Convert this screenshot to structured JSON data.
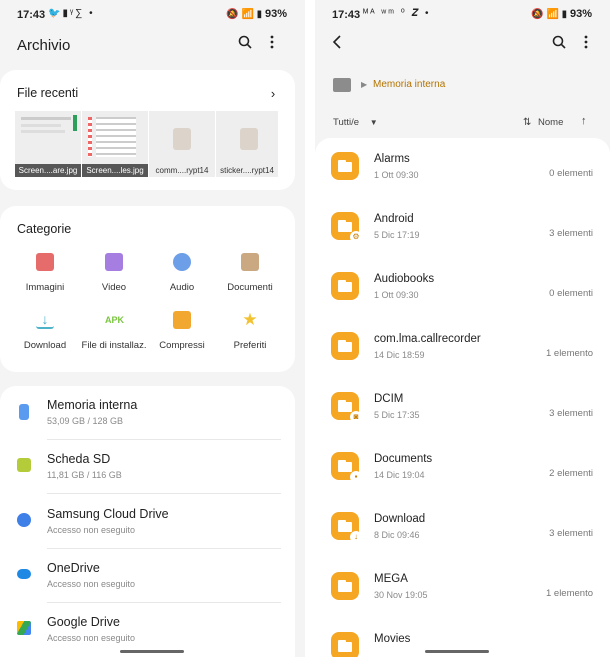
{
  "left": {
    "status": {
      "time": "17:43",
      "notifications": "🐦▮ᵞ∑ •",
      "right_icons": "🔕 📶 ▮",
      "battery": "93%"
    },
    "appbar": {
      "title": "Archivio",
      "search_icon": "search-icon",
      "more_icon": "more-vertical-icon"
    },
    "recent": {
      "title": "File recenti",
      "files": [
        {
          "name": "Screen....are.jpg"
        },
        {
          "name": "Screen....les.jpg"
        },
        {
          "name": "comm....rypt14"
        },
        {
          "name": "sticker....rypt14"
        }
      ]
    },
    "categories": {
      "title": "Categorie",
      "items": [
        {
          "label": "Immagini",
          "color": "#e66b6b"
        },
        {
          "label": "Video",
          "color": "#a67de0"
        },
        {
          "label": "Audio",
          "color": "#6d9ee8"
        },
        {
          "label": "Documenti",
          "color": "#c9a882"
        },
        {
          "label": "Download",
          "color": "#4cb3c9"
        },
        {
          "label": "File di installaz.",
          "color": "#7bc640"
        },
        {
          "label": "Compressi",
          "color": "#f2a830"
        },
        {
          "label": "Preferiti",
          "color": "#f2c230"
        }
      ]
    },
    "storage": [
      {
        "name": "Memoria interna",
        "sub": "53,09 GB / 128 GB",
        "color": "#5a9bf0"
      },
      {
        "name": "Scheda SD",
        "sub": "11,81 GB / 116 GB",
        "color": "#b5cc3a"
      },
      {
        "name": "Samsung Cloud Drive",
        "sub": "Accesso non eseguito",
        "color": "#3f7fe8"
      },
      {
        "name": "OneDrive",
        "sub": "Accesso non eseguito",
        "color": "#1e88e5"
      },
      {
        "name": "Google Drive",
        "sub": "Accesso non eseguito",
        "color": "#34a853"
      }
    ]
  },
  "right": {
    "status": {
      "time": "17:43",
      "notifications": "ᴹᴬ ʷᵐ ⁰ 𝒁 •",
      "right_icons": "🔕 📶 ▮",
      "battery": "93%"
    },
    "appbar": {
      "back_icon": "back-arrow-icon",
      "search_icon": "search-icon",
      "more_icon": "more-vertical-icon"
    },
    "breadcrumb": {
      "home_icon": "home-icon",
      "path": "Memoria interna"
    },
    "sort": {
      "filter": "Tutti/e",
      "order": "Nome"
    },
    "folders": [
      {
        "name": "Alarms",
        "date": "1 Ott 09:30",
        "count": "0 elementi",
        "badge": ""
      },
      {
        "name": "Android",
        "date": "5 Dic 17:19",
        "count": "3 elementi",
        "badge": "⚙"
      },
      {
        "name": "Audiobooks",
        "date": "1 Ott 09:30",
        "count": "0 elementi",
        "badge": ""
      },
      {
        "name": "com.lma.callrecorder",
        "date": "14 Dic 18:59",
        "count": "1 elemento",
        "badge": ""
      },
      {
        "name": "DCIM",
        "date": "5 Dic 17:35",
        "count": "3 elementi",
        "badge": "◙"
      },
      {
        "name": "Documents",
        "date": "14 Dic 19:04",
        "count": "2 elementi",
        "badge": "▪"
      },
      {
        "name": "Download",
        "date": "8 Dic 09:46",
        "count": "3 elementi",
        "badge": "↓"
      },
      {
        "name": "MEGA",
        "date": "30 Nov 19:05",
        "count": "1 elemento",
        "badge": ""
      },
      {
        "name": "Movies",
        "date": "",
        "count": "",
        "badge": ""
      }
    ]
  }
}
